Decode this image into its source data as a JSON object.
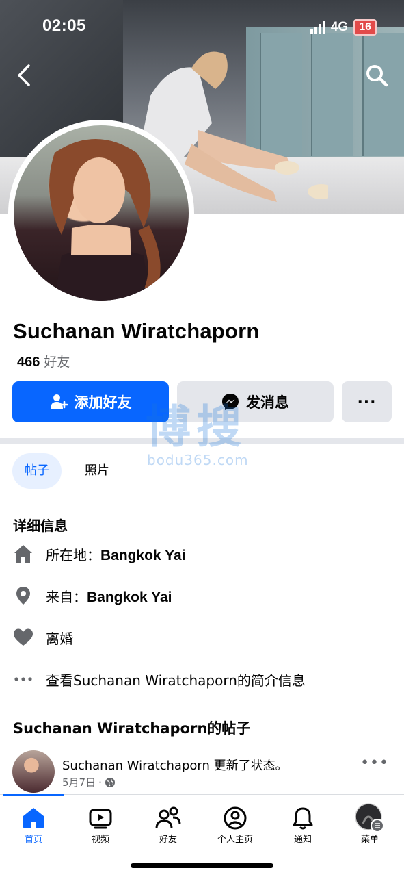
{
  "status_bar": {
    "time": "02:05",
    "network": "4G",
    "battery": "16"
  },
  "profile": {
    "name": "Suchanan Wiratchaporn",
    "friend_count": "466",
    "friend_label": "好友"
  },
  "actions": {
    "add_friend": "添加好友",
    "message": "发消息",
    "more": "···"
  },
  "tabs": [
    {
      "label": "帖子",
      "active": true
    },
    {
      "label": "照片",
      "active": false
    }
  ],
  "details": {
    "title": "详细信息",
    "lives_in_label": "所在地：",
    "lives_in_value": "Bangkok Yai",
    "from_label": "来自：",
    "from_value": "Bangkok Yai",
    "relationship": "离婚",
    "see_about": "查看Suchanan Wiratchaporn的简介信息"
  },
  "posts": {
    "title": "Suchanan Wiratchaporn的帖子",
    "items": [
      {
        "author": "Suchanan Wiratchaporn",
        "action": "更新了状态。",
        "date": "5月7日",
        "privacy_icon": "globe-icon"
      }
    ]
  },
  "bottom_nav": [
    {
      "label": "首页",
      "icon": "home-icon",
      "active": true
    },
    {
      "label": "视频",
      "icon": "video-icon",
      "active": false
    },
    {
      "label": "好友",
      "icon": "friends-icon",
      "active": false
    },
    {
      "label": "个人主页",
      "icon": "profile-icon",
      "active": false
    },
    {
      "label": "通知",
      "icon": "bell-icon",
      "active": false
    },
    {
      "label": "菜单",
      "icon": "menu-avatar-icon",
      "active": false
    }
  ],
  "watermark": {
    "glyphs": "博搜",
    "url": "bodu365.com"
  },
  "colors": {
    "accent": "#0866ff",
    "secondary_button": "#e4e6eb",
    "muted_text": "#65676b"
  }
}
